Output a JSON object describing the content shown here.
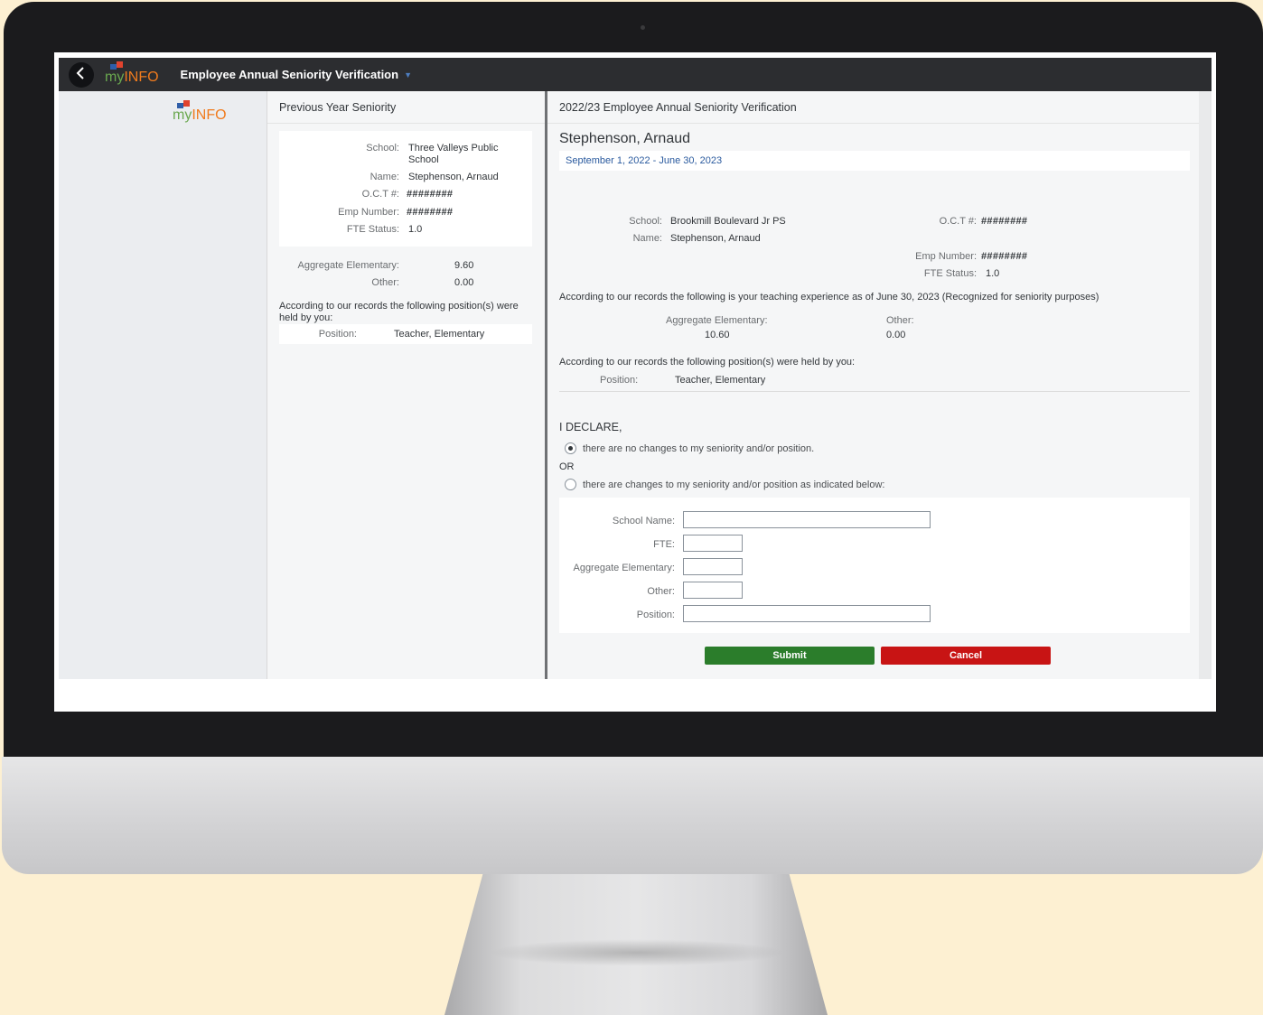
{
  "header": {
    "back_icon": "chevron-left-icon",
    "logo_my": "my",
    "logo_info": "INFO",
    "title": "Employee Annual Seniority Verification"
  },
  "previous": {
    "title": "Previous Year Seniority",
    "school_label": "School:",
    "school_line1": "Three Valleys Public",
    "school_line2": "School",
    "name_label": "Name:",
    "name": "Stephenson, Arnaud",
    "oct_label": "O.C.T #:",
    "oct": "########",
    "emp_label": "Emp Number:",
    "emp": "########",
    "fte_label": "FTE Status:",
    "fte": "1.0",
    "agg_label": "Aggregate Elementary:",
    "agg": "9.60",
    "other_label": "Other:",
    "other": "0.00",
    "records_line1": "According to our records the following position(s) were",
    "records_line2": "held by you:",
    "position_label": "Position:",
    "position": "Teacher, Elementary"
  },
  "current": {
    "title": "2022/23 Employee Annual Seniority Verification",
    "name_heading": "Stephenson, Arnaud",
    "period": "September 1, 2022 - June 30, 2023",
    "school_label": "School:",
    "school": "Brookmill Boulevard Jr PS",
    "name_label": "Name:",
    "name": "Stephenson, Arnaud",
    "oct_label": "O.C.T #:",
    "oct": "########",
    "emp_label": "Emp Number:",
    "emp": "########",
    "fte_label": "FTE Status:",
    "fte": "1.0",
    "experience_text": "According to our records the following is your teaching experience as of June 30, 2023 (Recognized for seniority purposes)",
    "agg_label": "Aggregate Elementary:",
    "agg": "10.60",
    "other_label": "Other:",
    "other": "0.00",
    "records_text": "According to our records the following position(s) were held by you:",
    "position_label": "Position:",
    "position": "Teacher, Elementary"
  },
  "declare": {
    "heading": "I DECLARE,",
    "option_no_changes": "there are no changes to my seniority and/or position.",
    "or": "OR",
    "option_changes": "there are changes to my seniority and/or position as indicated below:",
    "selected": "no_changes"
  },
  "form": {
    "school_name_label": "School Name:",
    "school_name": "",
    "fte_label": "FTE:",
    "fte": "",
    "agg_label": "Aggregate Elementary:",
    "agg": "",
    "other_label": "Other:",
    "other": "",
    "position_label": "Position:",
    "position": ""
  },
  "actions": {
    "submit": "Submit",
    "cancel": "Cancel",
    "submit_color": "#2b7d2b",
    "cancel_color": "#c81414"
  }
}
